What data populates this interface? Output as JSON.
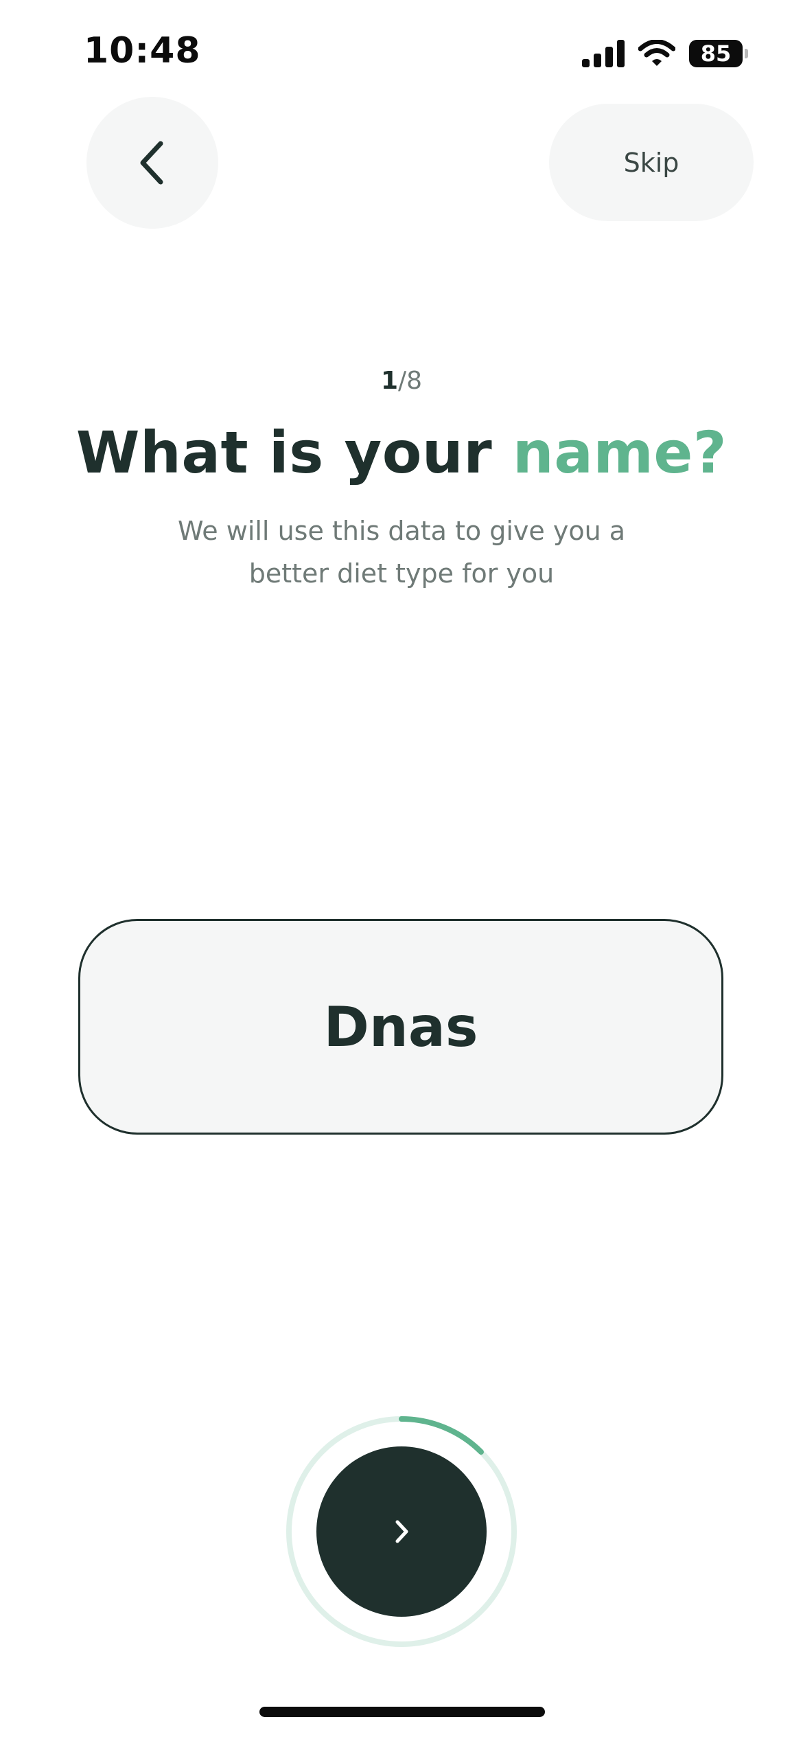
{
  "status_bar": {
    "time": "10:48",
    "battery": "85",
    "icons": [
      "signal-icon",
      "wifi-icon",
      "battery-icon"
    ]
  },
  "nav": {
    "back_icon": "chevron-left-icon",
    "skip_label": "Skip"
  },
  "step": {
    "current": "1",
    "separator": "/",
    "total": "8",
    "progress_fraction": 0.125
  },
  "question": {
    "title_main": "What is your ",
    "title_accent": "name?",
    "subtitle": "We will use this data to give you a better diet type for you"
  },
  "name_input": {
    "value": "Dnas",
    "placeholder": ""
  },
  "next_button": {
    "icon": "chevron-right-icon"
  },
  "colors": {
    "primary_dark": "#1f302d",
    "accent_green": "#5fb48e",
    "ring_track": "#dff0e9",
    "surface": "#f5f6f6",
    "muted_text": "#6f7a77"
  }
}
